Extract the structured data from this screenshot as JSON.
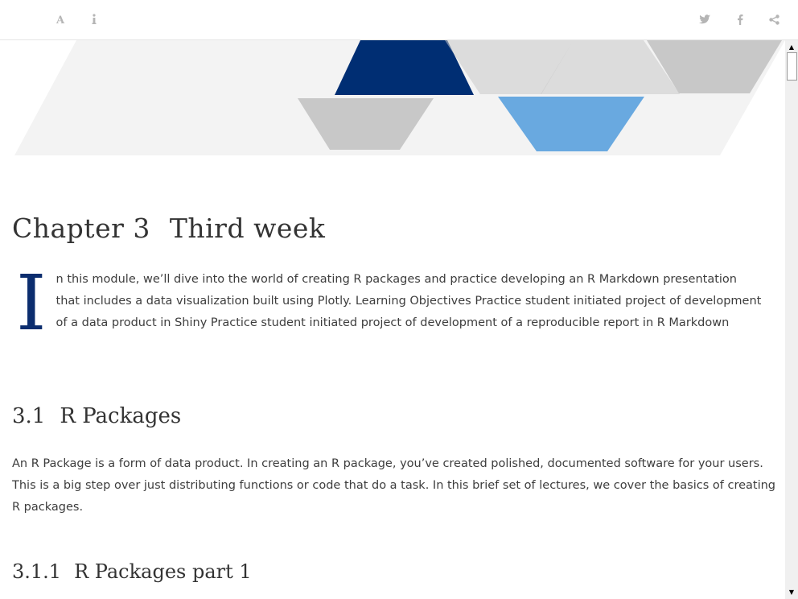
{
  "toolbar": {
    "left_icons": [
      "font-settings-icon",
      "info-icon"
    ],
    "right_icons": [
      "twitter-icon",
      "facebook-icon",
      "share-icon"
    ]
  },
  "banner": {
    "colors": {
      "dark_blue": "#002e73",
      "light_blue": "#69a9e0",
      "gray": "#c8c8c8",
      "light_gray": "#eeeeee"
    }
  },
  "chapter": {
    "number": "Chapter 3",
    "title": "Third week",
    "dropcap": "I",
    "intro": "n this module, we’ll dive into the world of creating R packages and practice developing an R Markdown presentation that includes a data visualization built using Plotly. Learning Objectives Practice student initiated project of development of a data product in Shiny Practice student initiated project of development of a reproducible report in R Markdown"
  },
  "section": {
    "number": "3.1",
    "title": "R Packages",
    "body": "An R Package is a form of data product. In creating an R package, you’ve created polished, documented software for your users. This is a big step over just distributing functions or code that do a task. In this brief set of lectures, we cover the basics of creating R packages."
  },
  "subsection": {
    "number": "3.1.1",
    "title": "R Packages part 1"
  }
}
